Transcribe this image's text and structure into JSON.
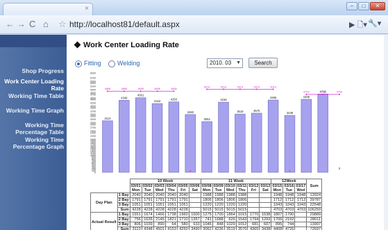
{
  "browser": {
    "url": "http://localhost81/default.aspx",
    "tab_close": "×",
    "window_buttons": [
      "–",
      "□",
      "✕"
    ],
    "page_menu": "▶ 🗋▾",
    "tool_menu": "🔧▾"
  },
  "sidebar": {
    "items": [
      {
        "label": "Shop Progress"
      },
      {
        "label": "Work Center Loading Rate"
      },
      {
        "label": "Working Time Table"
      },
      {
        "label": "Working Time Graph"
      },
      {
        "label": "Working Time Percentage Table"
      },
      {
        "label": "Working Time Percentage Graph"
      }
    ]
  },
  "page": {
    "title": "Work Center Loading Rate",
    "radio_fitting": "Fitting",
    "radio_welding": "Welding",
    "month_select": "2010. 03",
    "search_button": "Search"
  },
  "chart_data": {
    "type": "bar",
    "ylim": [
      0,
      6000
    ],
    "yticks": [
      0,
      100,
      200,
      300,
      400,
      500,
      600,
      700,
      800,
      900,
      1000,
      1100,
      1200,
      1300,
      1400,
      1500,
      1600,
      1700,
      1800,
      1900,
      2000,
      2100,
      2200,
      2300,
      2400,
      2500,
      2600,
      2700,
      2800,
      2900,
      3000,
      3100,
      3200,
      3300,
      3400,
      3500,
      3600,
      3700,
      3800,
      3900,
      4000,
      4100,
      4200,
      4300,
      4400,
      4500,
      4600,
      4700,
      4800,
      4900,
      5000,
      5100,
      5200,
      5300,
      5400,
      5500,
      5600,
      5700,
      5800,
      5900,
      6000
    ],
    "yticks_shown": [
      0,
      100,
      200,
      300,
      400,
      500,
      600,
      700,
      800,
      900,
      1000,
      1100,
      1200,
      1300,
      1400,
      1500,
      1600,
      1700,
      1800,
      1900,
      2000,
      2100,
      2200,
      2300,
      2400,
      2500,
      2600,
      2700,
      2800,
      2900,
      3000,
      3100,
      3200,
      3300,
      3400,
      3500,
      3600,
      3700,
      3800,
      3900,
      4000,
      4100,
      4200,
      4300,
      4400,
      4500,
      4600,
      4700,
      4800,
      4900,
      5000,
      5100,
      5200,
      5300,
      5400,
      5500,
      5600,
      5700,
      5800,
      5900,
      6000
    ],
    "categories": [
      "03/01",
      "03/02",
      "03/03",
      "03/04",
      "03/05",
      "03/06",
      "03/08",
      "03/09",
      "03/10",
      "03/11",
      "03/12",
      "03/13",
      "03/15",
      "03/16",
      "03/17"
    ],
    "actual": [
      3113,
      4348,
      4501,
      4153,
      4250,
      3490,
      3062,
      4236,
      3519,
      3570,
      4365,
      3438,
      4408,
      4726,
      0
    ],
    "actual_labels": [
      "3113",
      "4348",
      "4501",
      "4153",
      "4250",
      "3490",
      "3062",
      "4236",
      "3519",
      "3570",
      "4365",
      "3438",
      "4408",
      "4726",
      "0"
    ],
    "plan": [
      4898,
      4898,
      4898,
      4898,
      4898,
      0,
      5014,
      5014,
      5014,
      5014,
      5014,
      0,
      4703,
      4703,
      4703
    ],
    "plan_labels": [
      "4898",
      "4898",
      "4898",
      "4898",
      "4898",
      "",
      "5014",
      "5014",
      "5014",
      "5014",
      "5014",
      "",
      "4703",
      "4703",
      "4703"
    ],
    "colors": {
      "bar": "#a7a2ee",
      "bar_edge": "#6a66c8",
      "plan_line": "#d22ccd",
      "background": "#ffffff"
    }
  },
  "table": {
    "weeks": [
      {
        "label": "10 Week",
        "span": 6
      },
      {
        "label": "11 Week",
        "span": 6
      },
      {
        "label": "12Week",
        "span": 3
      }
    ],
    "dates": [
      "03/01",
      "03/02",
      "03/03",
      "03/04",
      "03/05",
      "03/06",
      "03/08",
      "03/09",
      "03/10",
      "03/11",
      "03/12",
      "03/13",
      "03/15",
      "03/16",
      "03/17"
    ],
    "days": [
      "Mon",
      "Tue",
      "Wed",
      "Thu",
      "Fri",
      "Sat",
      "Mon",
      "Tue",
      "Wed",
      "Thu",
      "Fri",
      "Sat",
      "Mon",
      "Tue",
      "Wed"
    ],
    "sum_header": "Sum",
    "groups": [
      {
        "name": "Day Plan",
        "rows": [
          {
            "bay": "1 Bay",
            "values": [
              "2040",
              "2040",
              "2040",
              "2040",
              "2040",
              "",
              "1988",
              "1988",
              "1988",
              "1988",
              "",
              "",
              "1948",
              "1948",
              "1948"
            ],
            "sum": "13924"
          },
          {
            "bay": "2 Bay",
            "values": [
              "1791",
              "1791",
              "1791",
              "1791",
              "1791",
              "",
              "1806",
              "1806",
              "1806",
              "1806",
              "",
              "",
              "1712",
              "1712",
              "1712"
            ],
            "sum": "39787"
          },
          {
            "bay": "3 Bay",
            "values": [
              "1051",
              "1051",
              "1051",
              "1051",
              "1051",
              "",
              "1220",
              "1220",
              "1220",
              "1220",
              "",
              "",
              "1043",
              "1043",
              "1043"
            ],
            "sum": "22548"
          },
          {
            "bay": "Sum",
            "values": [
              "4228",
              "4228",
              "4228",
              "4228",
              "4228",
              "",
              "5015",
              "5015",
              "5015",
              "5015",
              "",
              "",
              "4703",
              "4703",
              "4703"
            ],
            "sum": "106259"
          }
        ]
      },
      {
        "name": "Actual Result",
        "rows": [
          {
            "bay": "1 Bay",
            "values": [
              "1551",
              "1674",
              "1466",
              "1738",
              "1960",
              "1500",
              "1275",
              "1700",
              "1864",
              "1015",
              "1770",
              "1538",
              "1807",
              "1790",
              ""
            ],
            "sum": "29889"
          },
          {
            "bay": "2 Bay",
            "values": [
              "756",
              "1635",
              "2145",
              "1821",
              "1710",
              "1357",
              "741",
              "1688",
              "626",
              "1543",
              "1794",
              "1293",
              "1706",
              "2192",
              ""
            ],
            "sum": "28011"
          },
          {
            "bay": "3 Bay",
            "values": [
              "806",
              "1039",
              "890",
              "64",
              "580",
              "633",
              "1046",
              "848",
              "1029",
              "1012",
              "681",
              "607",
              "895",
              "744",
              ""
            ],
            "sum": "13997"
          },
          {
            "bay": "Sum",
            "values": [
              "3113",
              "4348",
              "4501",
              "4153",
              "4250",
              "3490",
              "3062",
              "4236",
              "3519",
              "3570",
              "4365",
              "3438",
              "4408",
              "4726",
              ""
            ],
            "sum": "72697"
          }
        ]
      }
    ]
  }
}
